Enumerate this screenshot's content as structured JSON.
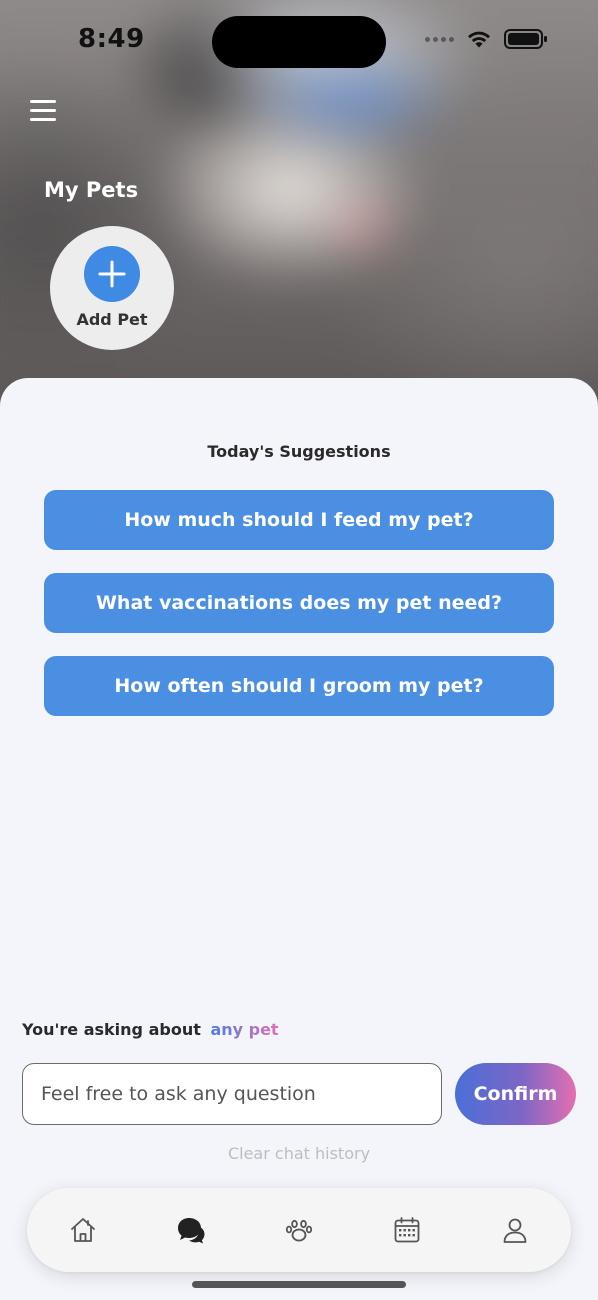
{
  "status_bar": {
    "time": "8:49"
  },
  "header": {
    "menu_icon": "hamburger-menu-icon",
    "my_pets_title": "My Pets",
    "add_pet_label": "Add Pet"
  },
  "suggestions": {
    "title": "Today's Suggestions",
    "items": [
      {
        "label": "How much should I feed my pet?"
      },
      {
        "label": "What vaccinations does my pet need?"
      },
      {
        "label": "How often should I groom my pet?"
      }
    ]
  },
  "ask": {
    "prefix": "You're asking about",
    "target": "any pet",
    "input_placeholder": "Feel free to ask any question",
    "input_value": "",
    "confirm_label": "Confirm",
    "clear_history_label": "Clear chat history"
  },
  "tabs": [
    {
      "icon": "home-icon",
      "active": false
    },
    {
      "icon": "chat-icon",
      "active": true
    },
    {
      "icon": "paw-icon",
      "active": false
    },
    {
      "icon": "calendar-icon",
      "active": false
    },
    {
      "icon": "user-icon",
      "active": false
    }
  ],
  "colors": {
    "accent_blue": "#4a8fe2",
    "gradient_start": "#4a6fd8",
    "gradient_end": "#e36fb0",
    "sheet_background": "#f3f5fa"
  }
}
